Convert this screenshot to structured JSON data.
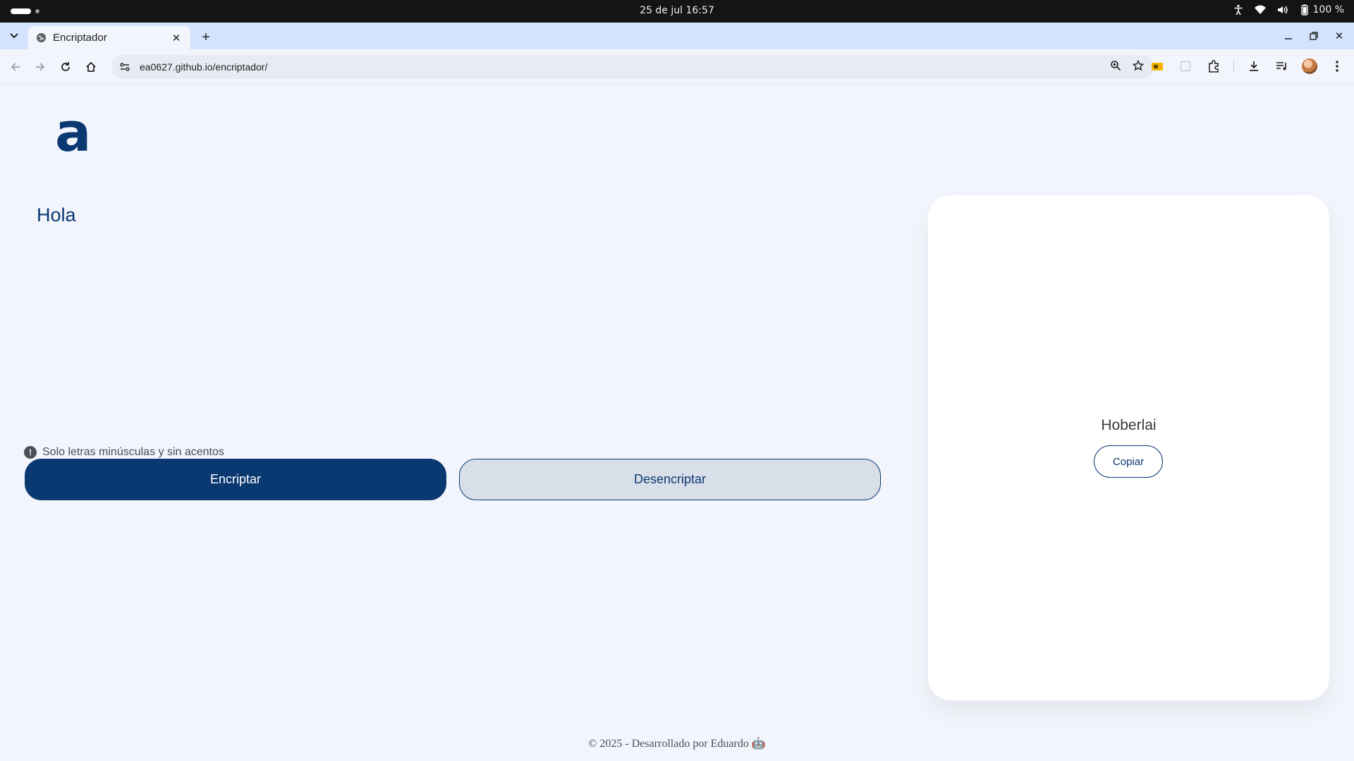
{
  "os": {
    "clock": "25 de jul  16:57",
    "battery": "100 %"
  },
  "browser": {
    "tab_title": "Encriptador",
    "new_tab_symbol": "+",
    "url": "ea0627.github.io/encriptador/"
  },
  "page": {
    "logo_text": "a",
    "input_value": "Hola",
    "hint": "Solo letras minúsculas y sin acentos",
    "encrypt_label": "Encriptar",
    "decrypt_label": "Desencriptar",
    "result_text": "Hoberlai",
    "copy_label": "Copiar",
    "footer": "© 2025 - Desarrollado por Eduardo 🤖"
  },
  "colors": {
    "primary": "#0a3871",
    "background": "#f3f5fc",
    "decrypt_bg": "#d8dfe8",
    "card": "#ffffff",
    "tab_strip": "#d3e3fd"
  },
  "icons": [
    "tab-search-icon",
    "globe-icon",
    "close-icon",
    "back-icon",
    "forward-icon",
    "reload-icon",
    "home-icon",
    "site-info-icon",
    "zoom-icon",
    "star-icon",
    "extension-icon",
    "download-icon",
    "media-icon",
    "menu-icon",
    "accessibility-icon",
    "wifi-icon",
    "volume-icon",
    "battery-icon",
    "info-icon"
  ]
}
